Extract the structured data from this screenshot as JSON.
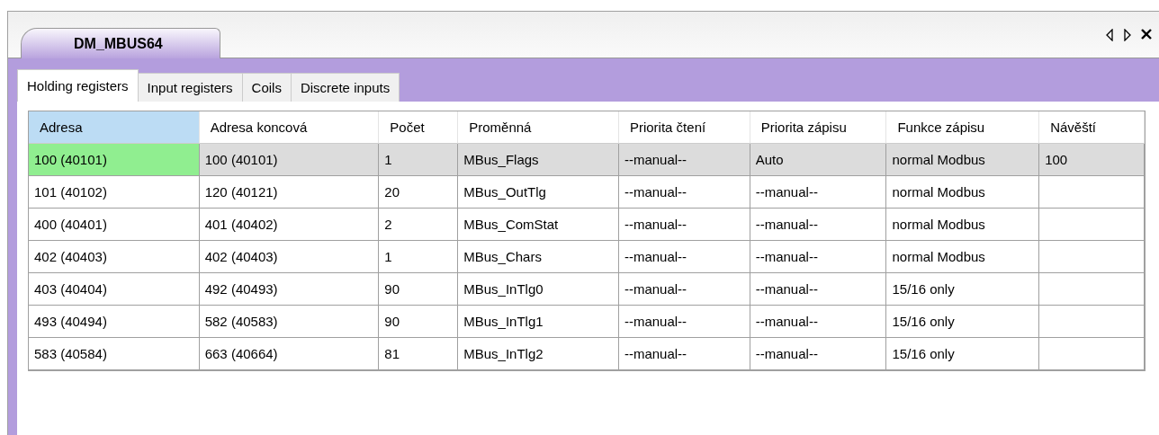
{
  "document_tab": {
    "title": "DM_MBUS64",
    "selected": true
  },
  "window_controls": [
    {
      "kind": "prev"
    },
    {
      "kind": "next"
    },
    {
      "kind": "close"
    }
  ],
  "tabs": [
    {
      "label": "Holding registers",
      "selected": true
    },
    {
      "label": "Input registers",
      "selected": false
    },
    {
      "label": "Coils",
      "selected": false
    },
    {
      "label": "Discrete inputs",
      "selected": false
    }
  ],
  "table": {
    "columns": [
      {
        "label": "Adresa",
        "selected": true
      },
      {
        "label": "Adresa koncová",
        "selected": false
      },
      {
        "label": "Počet",
        "selected": false
      },
      {
        "label": "Proměnná",
        "selected": false
      },
      {
        "label": "Priorita čtení",
        "selected": false
      },
      {
        "label": "Priorita zápisu",
        "selected": false
      },
      {
        "label": "Funkce zápisu",
        "selected": false
      },
      {
        "label": "Návěští",
        "selected": false
      }
    ],
    "rows": [
      {
        "selected": true,
        "cells": [
          "100 (40101)",
          "100 (40101)",
          "1",
          "MBus_Flags",
          "--manual--",
          "Auto",
          "normal Modbus",
          "100"
        ]
      },
      {
        "selected": false,
        "cells": [
          "101 (40102)",
          "120 (40121)",
          "20",
          "MBus_OutTlg",
          "--manual--",
          "--manual--",
          "normal Modbus",
          ""
        ]
      },
      {
        "selected": false,
        "cells": [
          "400 (40401)",
          "401 (40402)",
          "2",
          "MBus_ComStat",
          "--manual--",
          "--manual--",
          "normal Modbus",
          ""
        ]
      },
      {
        "selected": false,
        "cells": [
          "402 (40403)",
          "402 (40403)",
          "1",
          "MBus_Chars",
          "--manual--",
          "--manual--",
          "normal Modbus",
          ""
        ]
      },
      {
        "selected": false,
        "cells": [
          "403 (40404)",
          "492 (40493)",
          "90",
          "MBus_InTlg0",
          "--manual--",
          "--manual--",
          "15/16 only",
          ""
        ]
      },
      {
        "selected": false,
        "cells": [
          "493 (40494)",
          "582 (40583)",
          "90",
          "MBus_InTlg1",
          "--manual--",
          "--manual--",
          "15/16 only",
          ""
        ]
      },
      {
        "selected": false,
        "cells": [
          "583 (40584)",
          "663 (40664)",
          "81",
          "MBus_InTlg2",
          "--manual--",
          "--manual--",
          "15/16 only",
          ""
        ]
      }
    ]
  }
}
